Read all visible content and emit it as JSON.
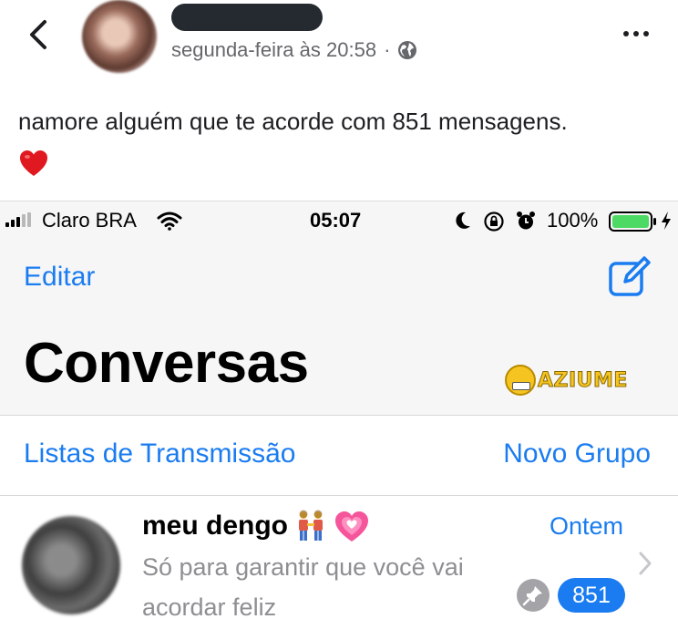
{
  "post": {
    "author_redacted": true,
    "timestamp": "segunda-feira às 20:58",
    "separator": "·",
    "text": "namore alguém que te acorde com 851 mensagens."
  },
  "icons": {
    "back": "chevron-left-icon",
    "privacy": "globe-icon",
    "more": "more-icon",
    "reaction": "red-heart-icon",
    "compose": "compose-icon",
    "pin": "pin-icon",
    "chevron": "chevron-right-icon"
  },
  "status_bar": {
    "carrier": "Claro BRA",
    "time": "05:07",
    "battery": "100%"
  },
  "whatsapp": {
    "edit_label": "Editar",
    "title": "Conversas",
    "broadcast_label": "Listas de Transmissão",
    "new_group_label": "Novo Grupo",
    "chat": {
      "name": "meu dengo",
      "time": "Ontem",
      "preview": "Só para garantir que você vai acordar feliz",
      "unread_count": "851"
    }
  },
  "watermark": {
    "text": "AZIUME"
  },
  "colors": {
    "ios_blue": "#1a7cf0",
    "fb_secondary": "#65676b",
    "battery_green": "#4cd964",
    "heart_red": "#e0181f"
  }
}
